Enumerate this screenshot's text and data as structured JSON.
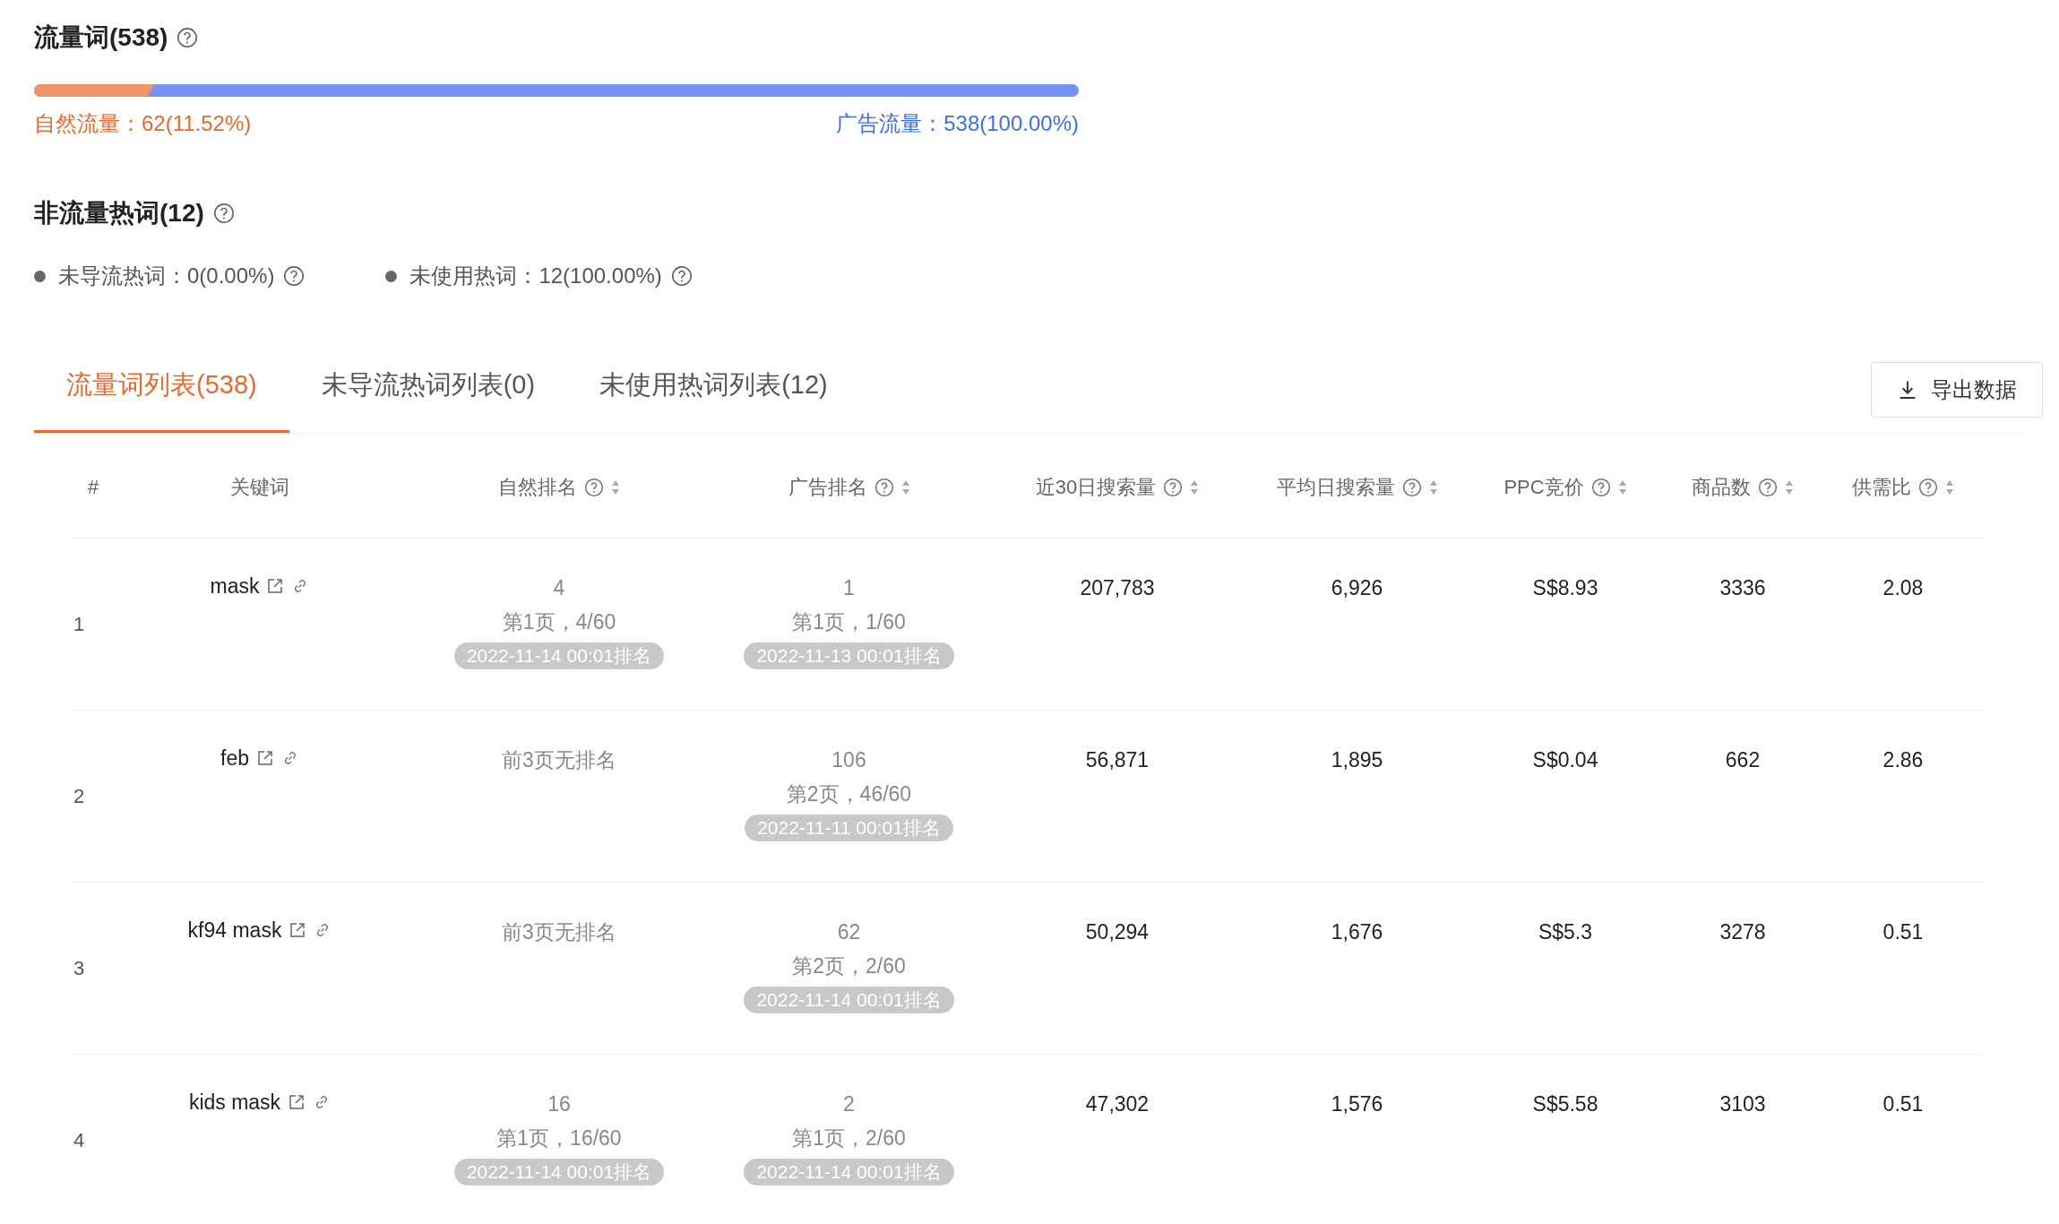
{
  "traffic_words": {
    "title": "流量词(538)",
    "bar": {
      "level": 0.1152
    },
    "organic_label": "自然流量：62(11.52%)",
    "ad_label": "广告流量：538(100.00%)"
  },
  "non_traffic": {
    "title": "非流量热词(12)",
    "items": [
      {
        "text": "未导流热词：0(0.00%)"
      },
      {
        "text": "未使用热词：12(100.00%)"
      }
    ]
  },
  "tabs": [
    {
      "label": "流量词列表(538)",
      "selected": true
    },
    {
      "label": "未导流热词列表(0)",
      "selected": false
    },
    {
      "label": "未使用热词列表(12)",
      "selected": false
    }
  ],
  "export_button": "导出数据",
  "table": {
    "columns": [
      {
        "label": "#",
        "help": false,
        "sortable": false
      },
      {
        "label": "关键词",
        "help": false,
        "sortable": false
      },
      {
        "label": "自然排名",
        "help": true,
        "sortable": true
      },
      {
        "label": "广告排名",
        "help": true,
        "sortable": true
      },
      {
        "label": "近30日搜索量",
        "help": true,
        "sortable": true
      },
      {
        "label": "平均日搜索量",
        "help": true,
        "sortable": true
      },
      {
        "label": "PPC竞价",
        "help": true,
        "sortable": true
      },
      {
        "label": "商品数",
        "help": true,
        "sortable": true
      },
      {
        "label": "供需比",
        "help": true,
        "sortable": true
      }
    ],
    "rows": [
      {
        "index": "1",
        "keyword": "mask",
        "organic": {
          "kind": "ranked",
          "rank": "4",
          "page": "第1页，4/60",
          "time": "2022-11-14 00:01排名"
        },
        "ad": {
          "kind": "ranked",
          "rank": "1",
          "page": "第1页，1/60",
          "time": "2022-11-13 00:01排名"
        },
        "search_30d": "207,783",
        "daily_search": "6,926",
        "ppc": "S$8.93",
        "products": "3336",
        "ratio": "2.08"
      },
      {
        "index": "2",
        "keyword": "feb",
        "organic": {
          "kind": "none",
          "text": "前3页无排名"
        },
        "ad": {
          "kind": "ranked",
          "rank": "106",
          "page": "第2页，46/60",
          "time": "2022-11-11 00:01排名"
        },
        "search_30d": "56,871",
        "daily_search": "1,895",
        "ppc": "S$0.04",
        "products": "662",
        "ratio": "2.86"
      },
      {
        "index": "3",
        "keyword": "kf94 mask",
        "organic": {
          "kind": "none",
          "text": "前3页无排名"
        },
        "ad": {
          "kind": "ranked",
          "rank": "62",
          "page": "第2页，2/60",
          "time": "2022-11-14 00:01排名"
        },
        "search_30d": "50,294",
        "daily_search": "1,676",
        "ppc": "S$5.3",
        "products": "3278",
        "ratio": "0.51"
      },
      {
        "index": "4",
        "keyword": "kids mask",
        "organic": {
          "kind": "ranked",
          "rank": "16",
          "page": "第1页，16/60",
          "time": "2022-11-14 00:01排名"
        },
        "ad": {
          "kind": "ranked",
          "rank": "2",
          "page": "第1页，2/60",
          "time": "2022-11-14 00:01排名"
        },
        "search_30d": "47,302",
        "daily_search": "1,576",
        "ppc": "S$5.58",
        "products": "3103",
        "ratio": "0.51"
      }
    ]
  }
}
